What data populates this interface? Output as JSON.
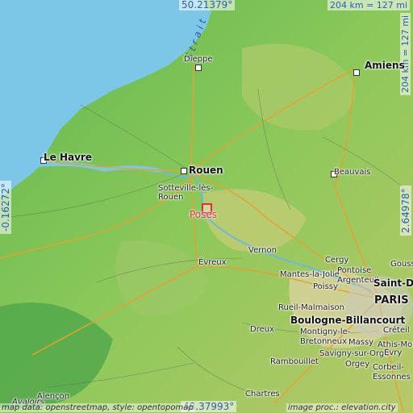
{
  "map": {
    "coords": {
      "top": "50.21379°",
      "bottom": "48.37993°",
      "left": "-0.16272°",
      "right": "2.64978°"
    },
    "scale_top": "204 km = 127 mi",
    "scale_right": "204 km = 127 mi",
    "sea_label": "Strait",
    "target": "Poses",
    "cities": {
      "dieppe": "Dieppe",
      "amiens": "Amiens",
      "le_havre": "Le Havre",
      "rouen": "Rouen",
      "sotteville": "Sotteville-lès-Rouen",
      "beauvais": "Beauvais",
      "vernon": "Vernon",
      "evreux": "Évreux",
      "cergy": "Cergy",
      "pontoise": "Pontoise",
      "mantes": "Mantes-la-Jolie",
      "argenteuil": "Argenteuil",
      "poissy": "Poissy",
      "saint_denis": "Saint-Denis",
      "gousse": "Gouss",
      "paris": "PARIS",
      "rueil": "Rueil-Malmaison",
      "boulogne": "Boulogne-Billancourt",
      "creteil": "Créteil",
      "dreux": "Dreux",
      "montigny": "Montigny-le-Bretonneux",
      "massy": "Massy",
      "savigny": "Savigny-sur-Orge",
      "athis": "Athis-Mons",
      "evry": "Évry",
      "orgeval": "Orgey",
      "corbeil": "Corbeil-Essonnes",
      "rambouillet": "Rambouillet",
      "chartres": "Chartres",
      "alencon": "Alençon",
      "avaloirs": "Avaloirs"
    },
    "attribution_left": "map data: openstreetmap, style: opentopomap",
    "attribution_right": "image proc.: elevation.city"
  }
}
